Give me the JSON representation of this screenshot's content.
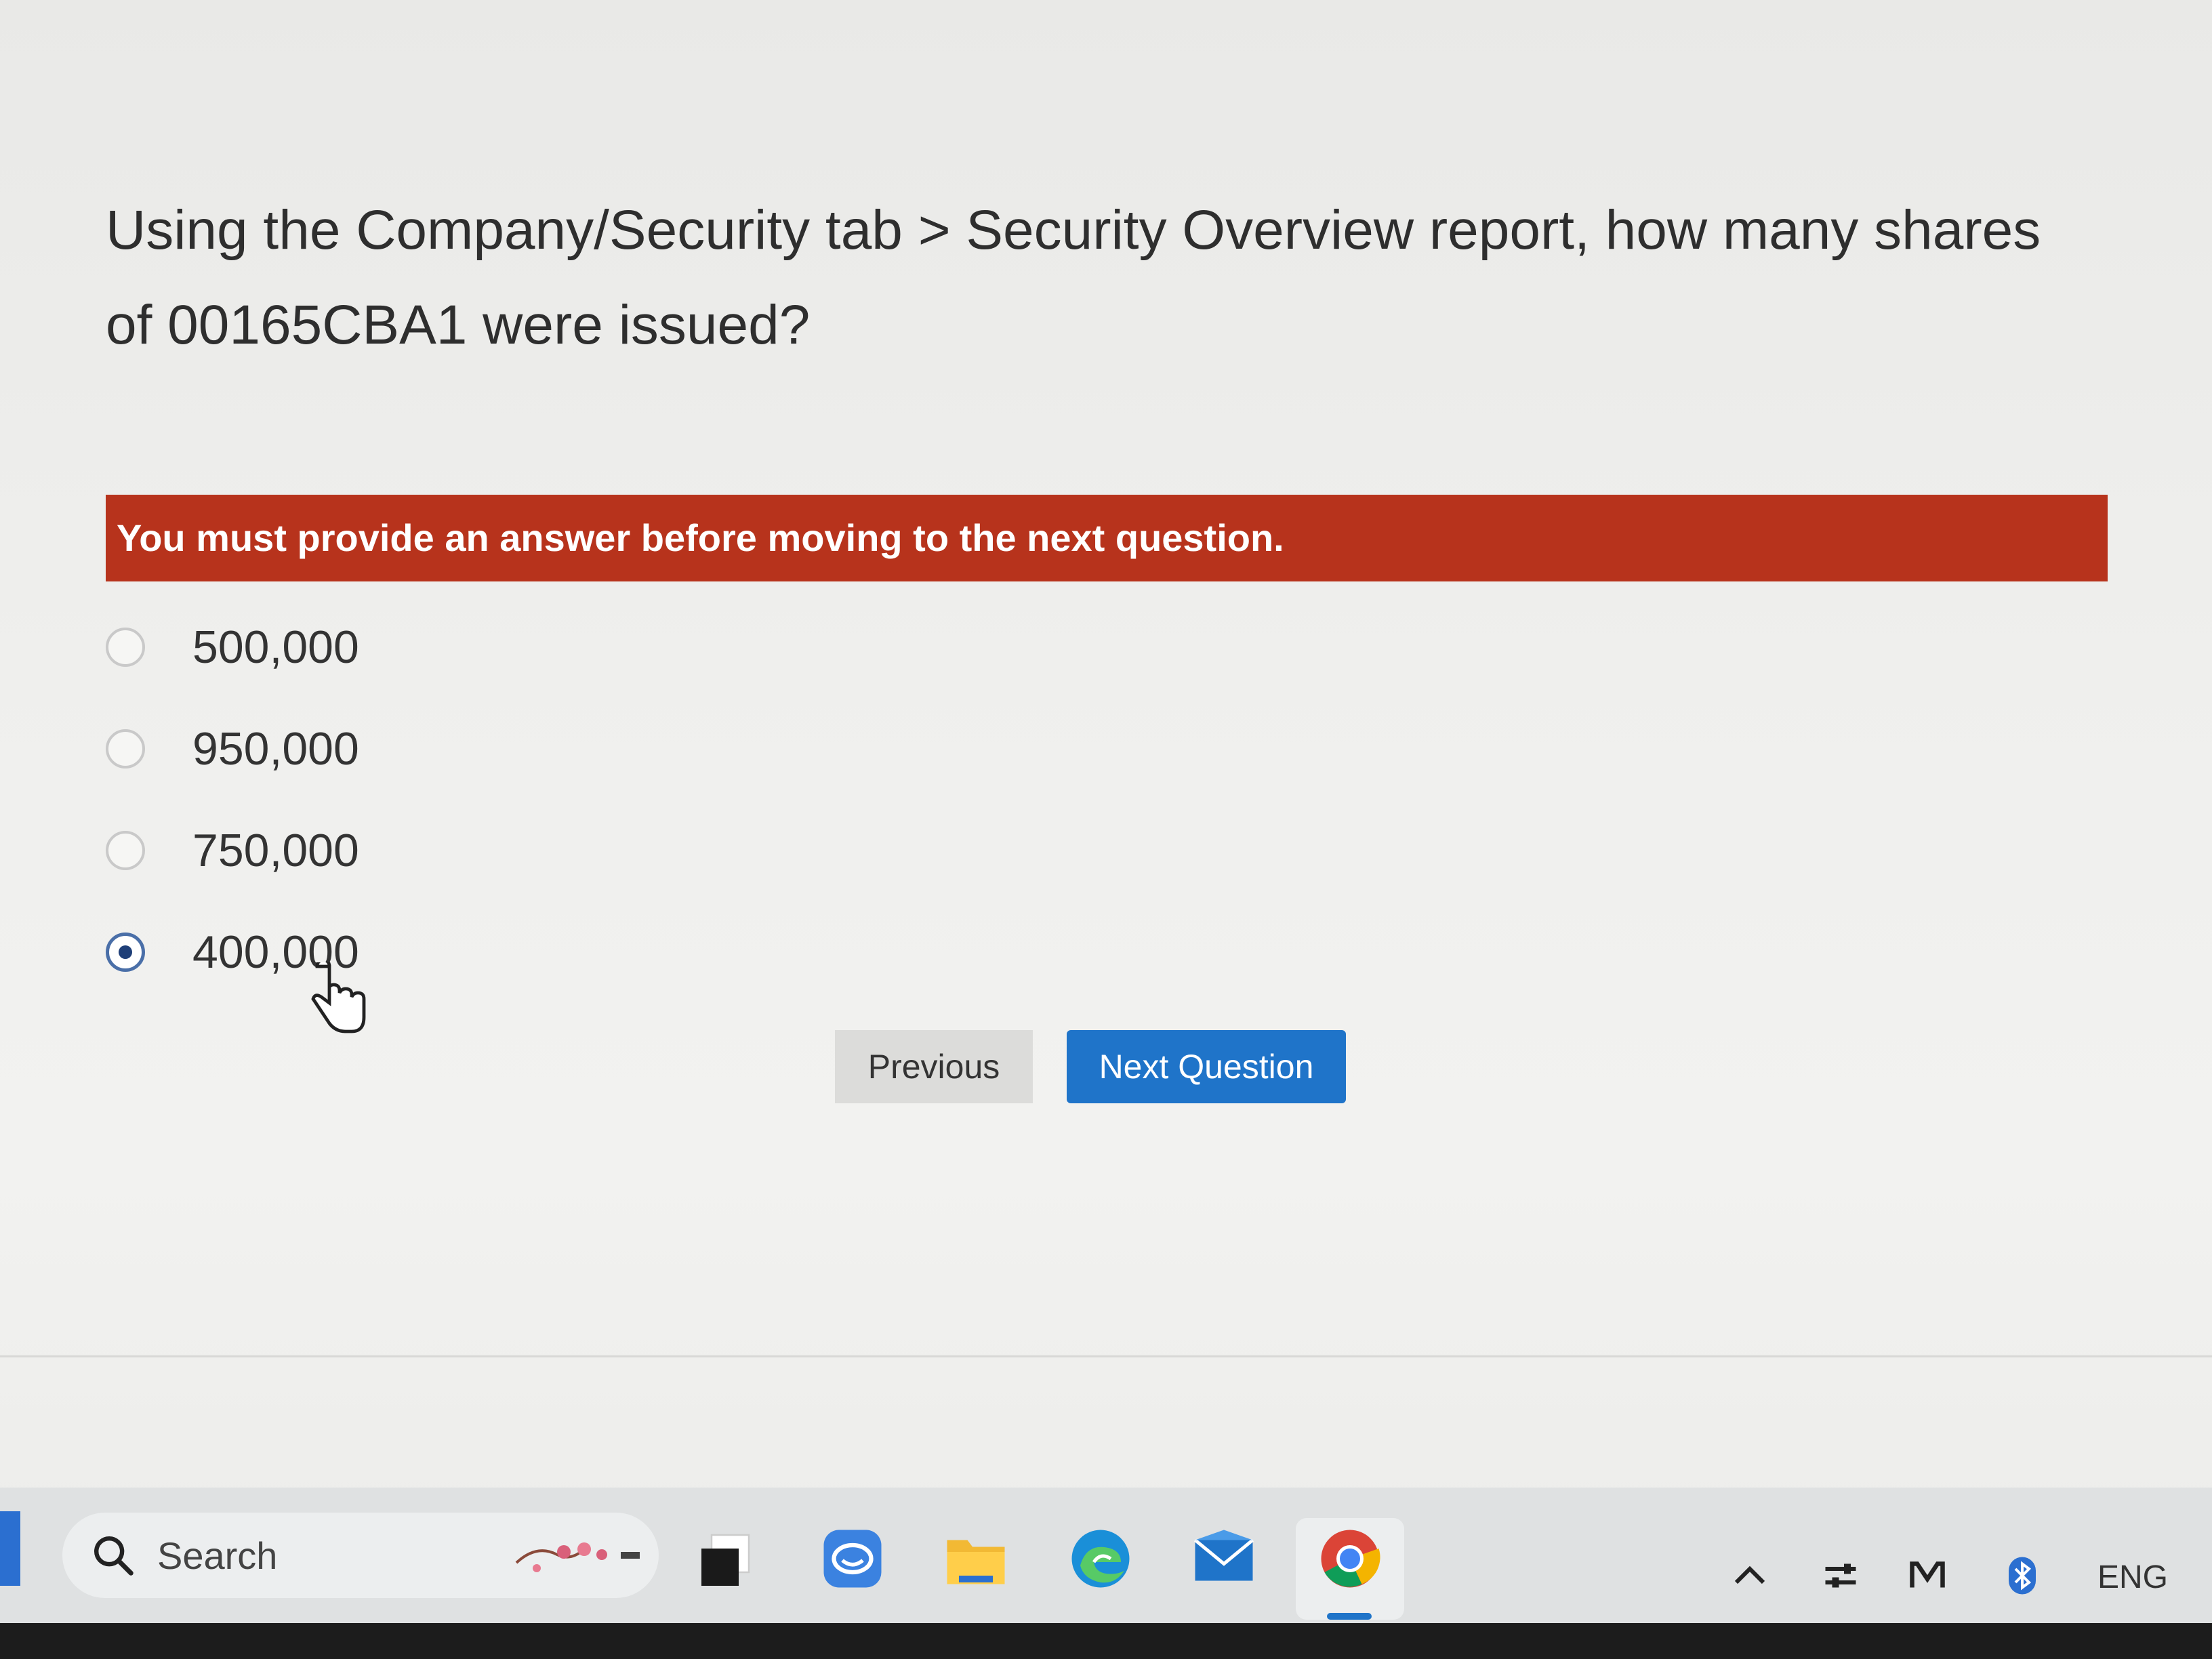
{
  "quiz": {
    "question": "Using the Company/Security tab > Security Overview report, how many shares of 00165CBA1 were issued?",
    "error_message": "You must provide an answer before moving to the next question.",
    "options": [
      {
        "label": "500,000",
        "selected": false
      },
      {
        "label": "950,000",
        "selected": false
      },
      {
        "label": "750,000",
        "selected": false
      },
      {
        "label": "400,000",
        "selected": true
      }
    ],
    "previous_label": "Previous",
    "next_label": "Next Question"
  },
  "taskbar": {
    "search_label": "Search",
    "language": "ENG",
    "icons": [
      "start-icon",
      "search-icon",
      "task-view-icon",
      "chat-icon",
      "file-explorer-icon",
      "edge-icon",
      "mail-icon",
      "chrome-icon"
    ],
    "tray_icons": [
      "chevron-up-icon",
      "network-icon",
      "app-tray-icon",
      "bluetooth-icon"
    ]
  },
  "colors": {
    "error_banner": "#b7331c",
    "primary_button": "#1f74c9",
    "secondary_button": "#dcdcda"
  }
}
